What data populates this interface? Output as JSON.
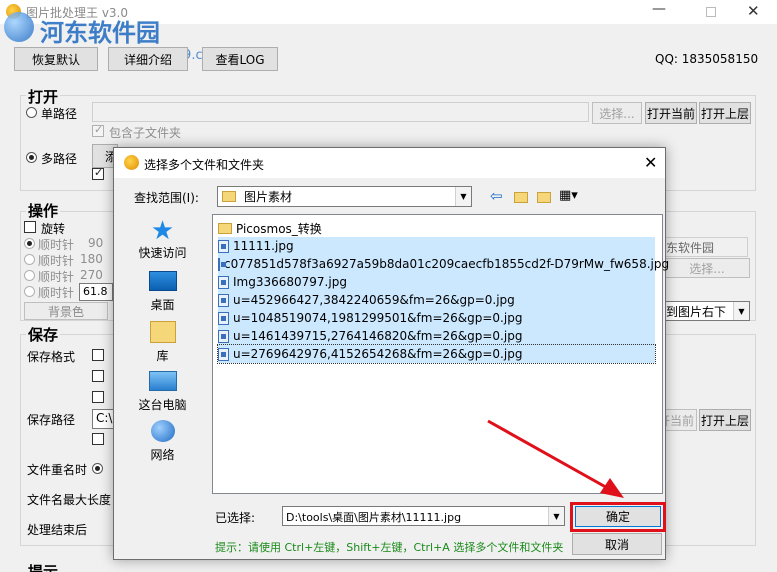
{
  "window": {
    "title": "图片批处理王 v3.0"
  },
  "watermark": {
    "site": "河东软件园",
    "url": "www.pc0359.cn"
  },
  "toolbar": {
    "restore_defaults": "恢复默认",
    "details": "详细介绍",
    "view_log": "查看LOG",
    "qq": "QQ: 1835058150"
  },
  "open": {
    "title": "打开",
    "single_path": "单路径",
    "include_sub": "包含子文件夹",
    "browse": "选择...",
    "open_current": "打开当前",
    "open_parent": "打开上层",
    "multi_path": "多路径",
    "add_partial": "添"
  },
  "operations": {
    "title": "操作",
    "rotate": "旋转",
    "cw90": "顺时针",
    "cw90_val": "90",
    "cw180": "顺时针",
    "cw180_val": "180",
    "cw270": "顺时针",
    "cw270_val": "270",
    "cw_custom": "顺时针",
    "cw_custom_val": "61.8",
    "bg_color": "背景色",
    "wm_text": "东软件园",
    "wm_browse": "选择...",
    "wm_pos": "到图片右下"
  },
  "save": {
    "title": "保存",
    "format": "保存格式",
    "path": "保存路径",
    "path_value": "C:\\",
    "rename": "文件重名时",
    "max_len": "文件名最大长度",
    "after": "处理结束后",
    "open_current": "打开当前",
    "open_parent": "打开上层"
  },
  "hint_section": {
    "title": "提示"
  },
  "dialog": {
    "title": "选择多个文件和文件夹",
    "lookin_label": "查找范围(I):",
    "lookin_value": "图片素材",
    "places": [
      "快速访问",
      "桌面",
      "库",
      "这台电脑",
      "网络"
    ],
    "files": [
      {
        "name": "Picosmos_转换",
        "type": "folder",
        "selected": false
      },
      {
        "name": "11111.jpg",
        "type": "image",
        "selected": true
      },
      {
        "name": "c077851d578f3a6927a59b8da01c209caecfb1855cd2f-D79rMw_fw658.jpg",
        "type": "image",
        "selected": true
      },
      {
        "name": "Img336680797.jpg",
        "type": "image",
        "selected": true
      },
      {
        "name": "u=452966427,3842240659&fm=26&gp=0.jpg",
        "type": "image",
        "selected": true
      },
      {
        "name": "u=1048519074,1981299501&fm=26&gp=0.jpg",
        "type": "image",
        "selected": true
      },
      {
        "name": "u=1461439715,2764146820&fm=26&gp=0.jpg",
        "type": "image",
        "selected": true
      },
      {
        "name": "u=2769642976,4152654268&fm=26&gp=0.jpg",
        "type": "image",
        "selected": true
      }
    ],
    "selected_label": "已选择:",
    "selected_value": "D:\\tools\\桌面\\图片素材\\11111.jpg",
    "hint": "提示：请使用 Ctrl+左键，Shift+左键，Ctrl+A 选择多个文件和文件夹",
    "ok": "确定",
    "cancel": "取消"
  },
  "colors": {
    "selection": "#cce8ff",
    "highlight_box": "#e0101a",
    "arrow": "#e0101a",
    "hint_green": "#1a8a1a",
    "watermark_blue": "#1e6ac2"
  }
}
